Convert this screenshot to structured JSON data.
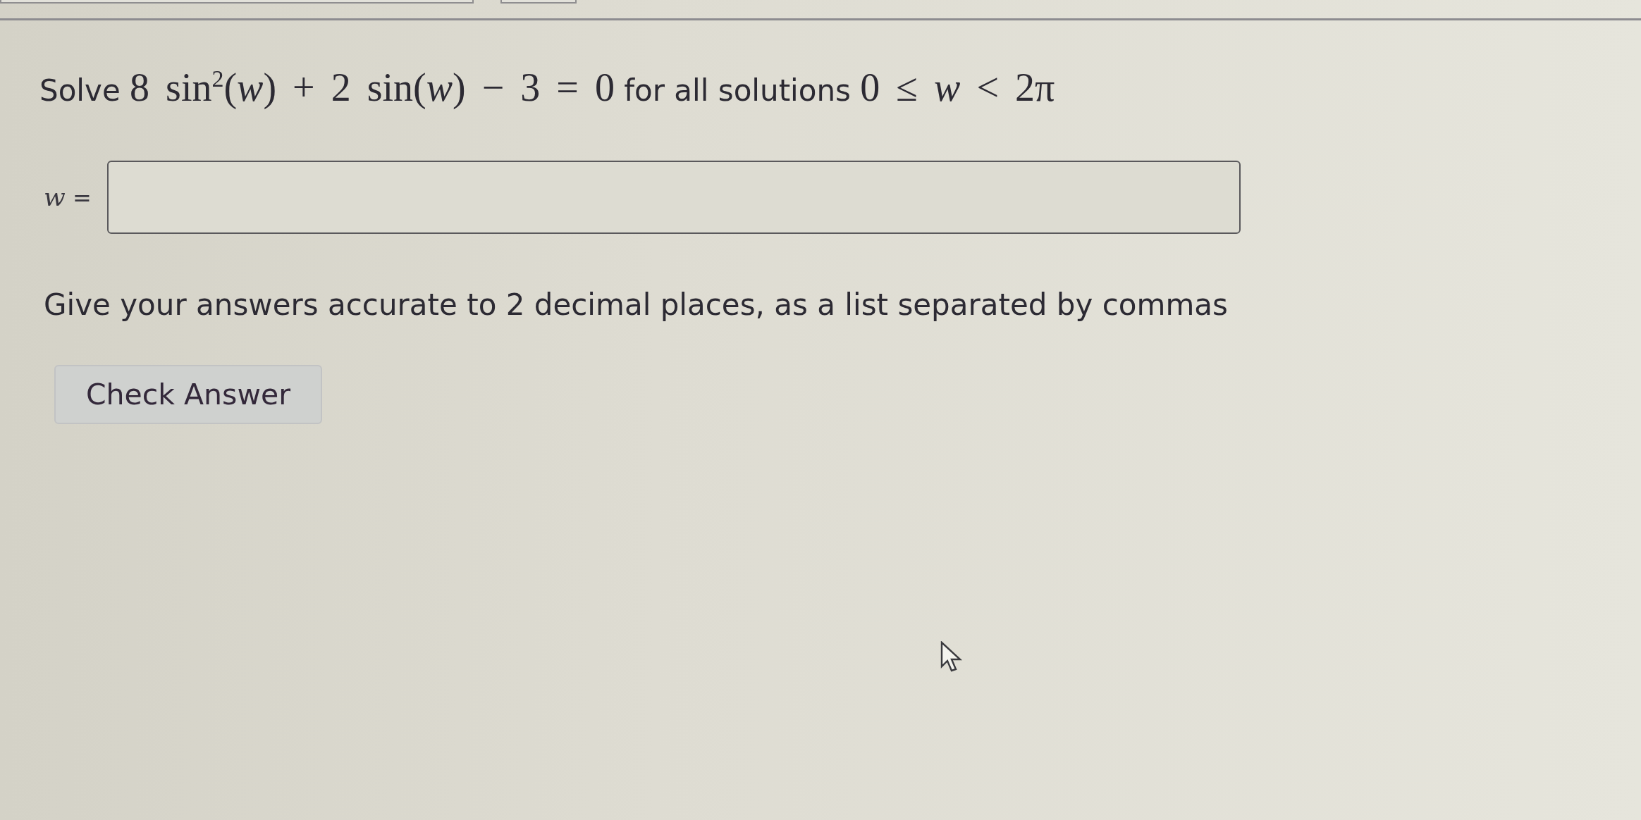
{
  "question": {
    "parts": [
      {
        "kind": "text",
        "text": "Solve"
      },
      {
        "kind": "math",
        "text": "8 sin$^{2}$(*w*) + 2 sin(*w*) − 3 = 0"
      },
      {
        "kind": "text",
        "text": "for all solutions"
      },
      {
        "kind": "math",
        "text": "0 ≤ *w* < 2π"
      }
    ]
  },
  "answer": {
    "label": [
      {
        "kind": "math",
        "text": "*w*"
      },
      {
        "kind": "text",
        "text": "="
      }
    ]
  },
  "instruction": "Give your answers accurate to 2 decimal places, as a list separated by commas",
  "buttons": [
    "Check Answer"
  ]
}
